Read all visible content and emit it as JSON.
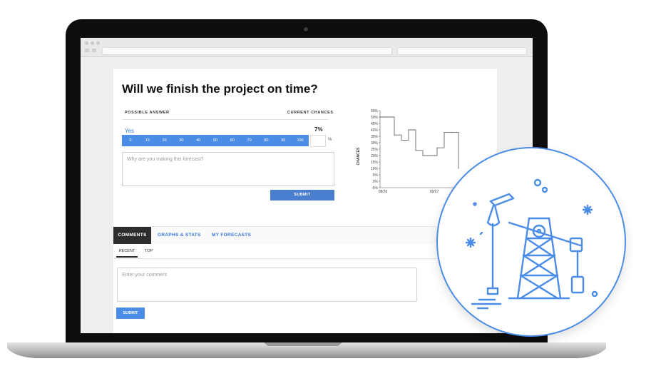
{
  "question": {
    "title": "Will we finish the project on time?"
  },
  "form": {
    "possible_answer_header": "POSSIBLE ANSWER",
    "current_chances_header": "CURRENT CHANCES",
    "answer": "Yes",
    "current_chance": "7%",
    "scale": [
      "0",
      "10",
      "20",
      "30",
      "40",
      "50",
      "60",
      "70",
      "80",
      "90",
      "100"
    ],
    "percent_sign": "%",
    "reason_placeholder": "Why are you making this forecast?",
    "submit_label": "SUBMIT"
  },
  "chart_data": {
    "type": "line",
    "ylabel": "CHANCES",
    "y_ticks": [
      "55%",
      "50%",
      "45%",
      "40%",
      "35%",
      "30%",
      "25%",
      "20%",
      "15%",
      "10%",
      "5%",
      "0%",
      "-5%"
    ],
    "x_ticks": [
      "08/26",
      "09/27"
    ],
    "ylim": [
      -5,
      55
    ],
    "step": true,
    "x": [
      0,
      1,
      2,
      3,
      4,
      5,
      6,
      7,
      8,
      9,
      10,
      11
    ],
    "values": [
      50,
      50,
      36,
      32,
      40,
      24,
      20,
      20,
      26,
      38,
      38,
      10
    ]
  },
  "tabs": {
    "comments": "COMMENTS",
    "graphs": "GRAPHS & STATS",
    "forecasts": "MY FORECASTS"
  },
  "subtabs": {
    "recent": "RECENT",
    "top": "TOP"
  },
  "comment": {
    "placeholder": "Enter your comment",
    "submit_label": "SUBMIT"
  },
  "badge": {
    "icon": "oil-pumpjack-icon",
    "color": "#4a8ce6"
  }
}
